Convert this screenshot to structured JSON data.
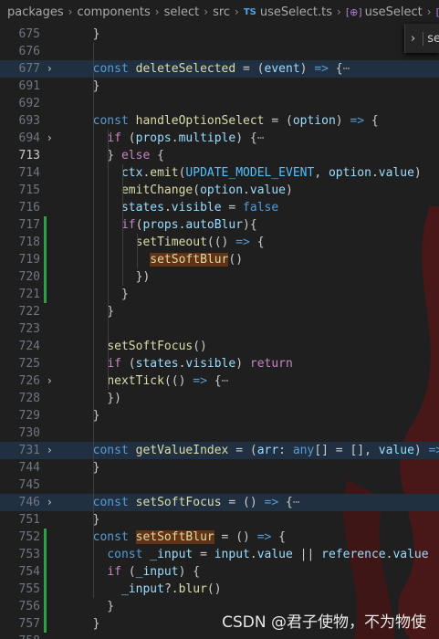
{
  "breadcrumb": {
    "items": [
      "packages",
      "components",
      "select",
      "src"
    ],
    "file_badge": "TS",
    "file": "useSelect.ts",
    "symbol1": "useSelect",
    "symbol2": "han"
  },
  "find_widget": {
    "text": "se"
  },
  "watermark": "CSDN @君子使物，不为物使",
  "colors": {
    "background": "#1f1f1f",
    "git_added": "#2ea043",
    "watermark_red": "#7a1414"
  },
  "lines": [
    {
      "n": "675",
      "code": "  }"
    },
    {
      "n": "676",
      "code": ""
    },
    {
      "n": "677",
      "code": "  const deleteSelected = (event) => {⋯"
    },
    {
      "n": "691",
      "code": "  }"
    },
    {
      "n": "692",
      "code": ""
    },
    {
      "n": "693",
      "code": "  const handleOptionSelect = (option) => {"
    },
    {
      "n": "694",
      "code": "    if (props.multiple) {⋯"
    },
    {
      "n": "713",
      "code": "    } else {"
    },
    {
      "n": "714",
      "code": "      ctx.emit(UPDATE_MODEL_EVENT, option.value)"
    },
    {
      "n": "715",
      "code": "      emitChange(option.value)"
    },
    {
      "n": "716",
      "code": "      states.visible = false"
    },
    {
      "n": "717",
      "code": "      if(props.autoBlur){"
    },
    {
      "n": "718",
      "code": "        setTimeout(() => {"
    },
    {
      "n": "719",
      "code": "          setSoftBlur()"
    },
    {
      "n": "720",
      "code": "        })"
    },
    {
      "n": "721",
      "code": "      }"
    },
    {
      "n": "722",
      "code": "    }"
    },
    {
      "n": "723",
      "code": ""
    },
    {
      "n": "724",
      "code": "    setSoftFocus()"
    },
    {
      "n": "725",
      "code": "    if (states.visible) return"
    },
    {
      "n": "726",
      "code": "    nextTick(() => {⋯"
    },
    {
      "n": "728",
      "code": "    })"
    },
    {
      "n": "729",
      "code": "  }"
    },
    {
      "n": "730",
      "code": ""
    },
    {
      "n": "731",
      "code": "  const getValueIndex = (arr: any[] = [], value) => {"
    },
    {
      "n": "744",
      "code": "  }"
    },
    {
      "n": "745",
      "code": ""
    },
    {
      "n": "746",
      "code": "  const setSoftFocus = () => {⋯"
    },
    {
      "n": "751",
      "code": "  }"
    },
    {
      "n": "752",
      "code": "  const setSoftBlur = () => {"
    },
    {
      "n": "753",
      "code": "    const _input = input.value || reference.value"
    },
    {
      "n": "754",
      "code": "    if (_input) {"
    },
    {
      "n": "755",
      "code": "      _input?.blur()"
    },
    {
      "n": "756",
      "code": "    }"
    },
    {
      "n": "757",
      "code": "  }"
    },
    {
      "n": "758",
      "code": ""
    }
  ]
}
